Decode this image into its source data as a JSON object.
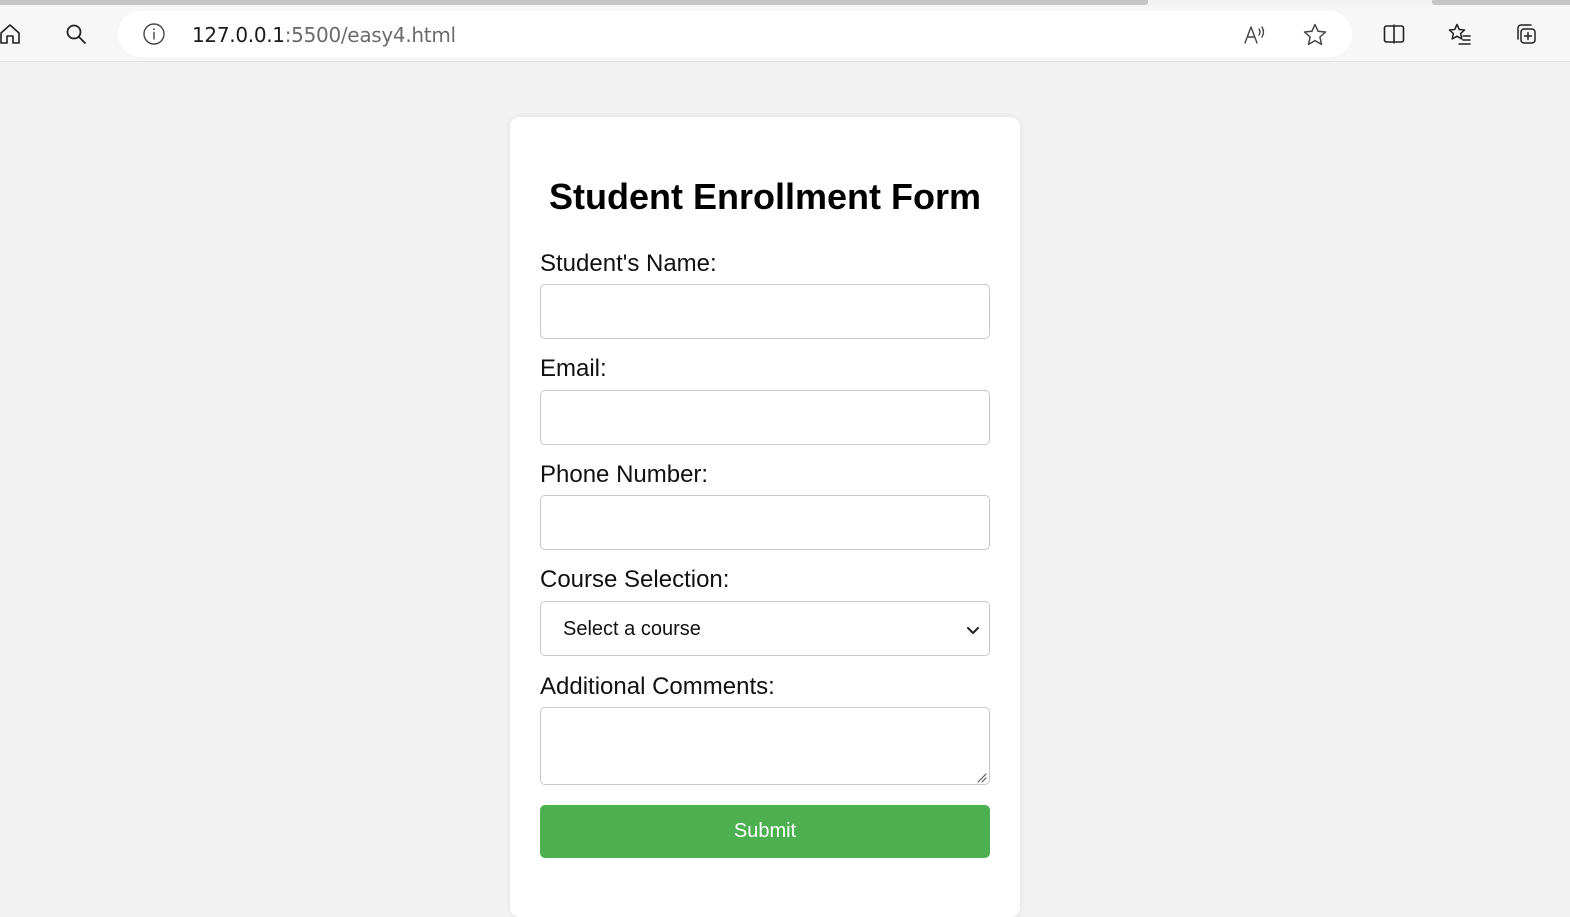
{
  "browser": {
    "url_host": "127.0.0.1",
    "url_path": ":5500/easy4.html",
    "icons": [
      "home-icon",
      "search-icon",
      "info-icon",
      "read-aloud-icon",
      "favorite-star-icon",
      "split-screen-icon",
      "favorites-list-icon",
      "collections-icon"
    ]
  },
  "form": {
    "title": "Student Enrollment Form",
    "name_label": "Student's Name:",
    "name_value": "",
    "email_label": "Email:",
    "email_value": "",
    "phone_label": "Phone Number:",
    "phone_value": "",
    "course_label": "Course Selection:",
    "course_selected": "Select a course",
    "comments_label": "Additional Comments:",
    "comments_value": "",
    "submit_label": "Submit"
  },
  "colors": {
    "page_background": "#f2f2f2",
    "card_background": "#ffffff",
    "submit_button": "#4caf50"
  }
}
